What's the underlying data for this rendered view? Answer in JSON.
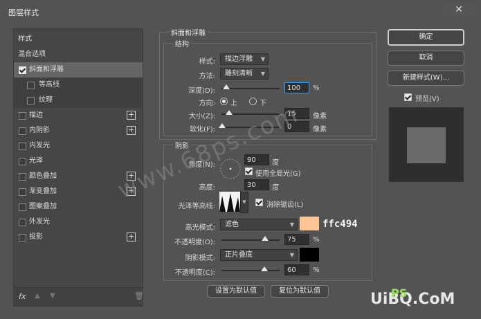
{
  "window": {
    "title": "图层样式",
    "close_glyph": "✕"
  },
  "left_panel": {
    "items": [
      {
        "label": "样式",
        "checkbox": false,
        "plus": false
      },
      {
        "label": "混合选项",
        "checkbox": false,
        "plus": false
      },
      {
        "label": "斜面和浮雕",
        "checkbox": true,
        "checked": true,
        "plus": false,
        "selected": true
      },
      {
        "label": "等高线",
        "checkbox": true,
        "checked": false,
        "plus": false,
        "sub": true
      },
      {
        "label": "纹理",
        "checkbox": true,
        "checked": false,
        "plus": false,
        "sub": true
      },
      {
        "label": "描边",
        "checkbox": true,
        "checked": false,
        "plus": true
      },
      {
        "label": "内阴影",
        "checkbox": true,
        "checked": false,
        "plus": true
      },
      {
        "label": "内发光",
        "checkbox": true,
        "checked": false,
        "plus": false
      },
      {
        "label": "光泽",
        "checkbox": true,
        "checked": false,
        "plus": false
      },
      {
        "label": "颜色叠加",
        "checkbox": true,
        "checked": false,
        "plus": true
      },
      {
        "label": "渐变叠加",
        "checkbox": true,
        "checked": false,
        "plus": true
      },
      {
        "label": "图案叠加",
        "checkbox": true,
        "checked": false,
        "plus": false
      },
      {
        "label": "外发光",
        "checkbox": true,
        "checked": false,
        "plus": false
      },
      {
        "label": "投影",
        "checkbox": true,
        "checked": false,
        "plus": true
      }
    ],
    "plus_glyph": "+",
    "fx_label": "fx",
    "up_glyph": "▲",
    "down_glyph": "▼",
    "trash_glyph": "🗑"
  },
  "bevel": {
    "section_title": "斜面和浮雕",
    "structure_title": "结构",
    "style_label": "样式:",
    "style_value": "描边浮雕",
    "method_label": "方法:",
    "method_value": "雕刻清晰",
    "depth_label": "深度(D):",
    "depth_value": "100",
    "depth_percent": 1.0,
    "percent_unit": "%",
    "direction_label": "方向:",
    "direction_up": "上",
    "direction_down": "下",
    "direction_selected": "up",
    "size_label": "大小(Z):",
    "size_value": "15",
    "pixel_unit": "像素",
    "soften_label": "软化(F):",
    "soften_value": "0"
  },
  "shading": {
    "title": "阴影",
    "angle_label": "角度(N):",
    "angle_value": "90",
    "degree_unit": "度",
    "global_light_label": "使用全局光(G)",
    "global_light_checked": true,
    "altitude_label": "高度:",
    "altitude_value": "30",
    "gloss_label": "光泽等高线:",
    "antialias_label": "消除锯齿(L)",
    "antialias_checked": true,
    "highlight_label": "高光模式:",
    "highlight_value": "滤色",
    "highlight_color": "#ffc494",
    "highlight_hex_text": "ffc494",
    "highlight_opacity_label": "不透明度(O):",
    "highlight_opacity": "75",
    "shadow_label": "阴影模式:",
    "shadow_value": "正片叠底",
    "shadow_color": "#000000",
    "shadow_opacity_label": "不透明度(C):",
    "shadow_opacity": "60"
  },
  "footer": {
    "make_default": "设置为默认值",
    "reset_default": "复位为默认值"
  },
  "right": {
    "ok": "确定",
    "cancel": "取消",
    "new_style": "新建样式(W)...",
    "preview_label": "预览(V)",
    "preview_checked": true
  },
  "watermark": "www.68ps.com",
  "logo": {
    "text": "UiBQ.CoM",
    "ps": "PS"
  }
}
